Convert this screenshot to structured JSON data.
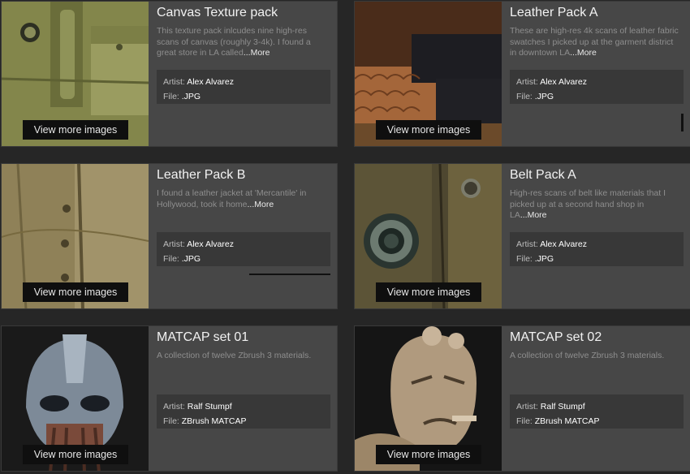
{
  "items": [
    {
      "title": "Canvas Texture pack",
      "description": "This texture pack inlcudes nine high-res scans of canvas (roughly 3-4k). I found a great store in LA called",
      "more": "...More",
      "artist_label": "Artist:",
      "artist": "Alex Alvarez",
      "file_label": "File:",
      "file": ".JPG",
      "button": "View more images",
      "thumb_icon": "canvas-jacket-image"
    },
    {
      "title": "Leather Pack A",
      "description": "These are high-res 4k scans of leather fabric swatches I picked up at the garment district in downtown LA",
      "more": "...More",
      "artist_label": "Artist:",
      "artist": "Alex Alvarez",
      "file_label": "File:",
      "file": ".JPG",
      "button": "View more images",
      "thumb_icon": "leather-swatches-image"
    },
    {
      "title": "Leather Pack B",
      "description": "I found a leather jacket at 'Mercantile' in Hollywood, took it home",
      "more": "...More",
      "artist_label": "Artist:",
      "artist": "Alex Alvarez",
      "file_label": "File:",
      "file": ".JPG",
      "button": "View more images",
      "thumb_icon": "leather-jacket-image"
    },
    {
      "title": "Belt Pack A",
      "description": "High-res scans of belt like materials that I picked up at a second hand shop in LA",
      "more": "...More",
      "artist_label": "Artist:",
      "artist": "Alex Alvarez",
      "file_label": "File:",
      "file": ".JPG",
      "button": "View more images",
      "thumb_icon": "belt-grommet-image"
    },
    {
      "title": "MATCAP set 01",
      "description": "A collection of twelve Zbrush 3 materials.",
      "more": "",
      "artist_label": "Artist:",
      "artist": "Ralf Stumpf",
      "file_label": "File:",
      "file": "ZBrush MATCAP",
      "button": "View more images",
      "thumb_icon": "alien-sculpt-image"
    },
    {
      "title": "MATCAP set 02",
      "description": "A collection of twelve Zbrush 3 materials.",
      "more": "",
      "artist_label": "Artist:",
      "artist": "Ralf Stumpf",
      "file_label": "File:",
      "file": "ZBrush MATCAP",
      "button": "View more images",
      "thumb_icon": "hellboy-sculpt-image"
    }
  ],
  "colors": {
    "background": "#262626",
    "card": "#474747",
    "meta_box": "#383838",
    "button": "#0f0f0f"
  }
}
